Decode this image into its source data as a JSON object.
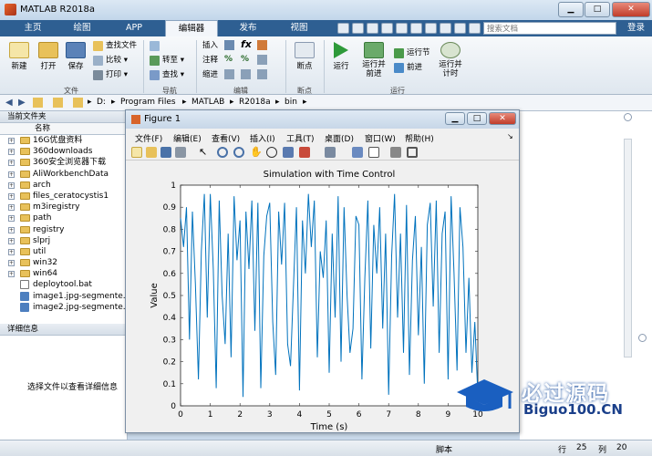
{
  "app": {
    "title": "MATLAB R2018a"
  },
  "tabs": [
    "主页",
    "绘图",
    "APP",
    "编辑器",
    "发布",
    "视图"
  ],
  "active_tab": "编辑器",
  "search": {
    "placeholder": "搜索文档"
  },
  "login_label": "登录",
  "ribbon": {
    "file": {
      "new": "新建",
      "open": "打开",
      "save": "保存",
      "find_files": "查找文件",
      "compare": "比较",
      "print": "打印",
      "group": "文件"
    },
    "nav": {
      "goto": "转至",
      "find": "查找",
      "group": "导航"
    },
    "edit": {
      "insert": "插入",
      "comment": "注释",
      "indent": "缩进",
      "group": "编辑"
    },
    "breakpoints": {
      "label": "断点",
      "group": "断点"
    },
    "run": {
      "run": "运行",
      "run_advance": "运行并\n前进",
      "run_section": "运行节",
      "advance": "前进",
      "run_time": "运行并\n计时",
      "group": "运行"
    }
  },
  "address": {
    "path": [
      "D:",
      "Program Files",
      "MATLAB",
      "R2018a",
      "bin"
    ]
  },
  "current_folder": {
    "title": "当前文件夹",
    "col_name": "名称",
    "items": [
      {
        "name": "16G优盘资料",
        "type": "folder"
      },
      {
        "name": "360downloads",
        "type": "folder"
      },
      {
        "name": "360安全浏览器下载",
        "type": "folder"
      },
      {
        "name": "AliWorkbenchData",
        "type": "folder"
      },
      {
        "name": "arch",
        "type": "folder"
      },
      {
        "name": "files_ceratocystis1",
        "type": "folder"
      },
      {
        "name": "m3iregistry",
        "type": "folder"
      },
      {
        "name": "path",
        "type": "folder"
      },
      {
        "name": "registry",
        "type": "folder"
      },
      {
        "name": "slprj",
        "type": "folder"
      },
      {
        "name": "util",
        "type": "folder"
      },
      {
        "name": "win32",
        "type": "folder"
      },
      {
        "name": "win64",
        "type": "folder"
      },
      {
        "name": "deploytool.bat",
        "type": "file"
      },
      {
        "name": "image1.jpg-segmente...",
        "type": "image"
      },
      {
        "name": "image2.jpg-segmente...",
        "type": "image"
      }
    ]
  },
  "details": {
    "title": "详细信息",
    "message": "选择文件以查看详细信息"
  },
  "status": {
    "script": "脚本",
    "row_label": "行",
    "row": "25",
    "col_label": "列",
    "col": "20"
  },
  "figure": {
    "title": "Figure 1",
    "menu": [
      "文件(F)",
      "编辑(E)",
      "查看(V)",
      "插入(I)",
      "工具(T)",
      "桌面(D)",
      "窗口(W)",
      "帮助(H)"
    ]
  },
  "watermark": {
    "line1": "必过源码",
    "line2": "Biguo100.CN"
  },
  "colors": {
    "tabbar": "#2e5f92",
    "line": "#0072bd",
    "ribbon_bg": "#eef2f6"
  },
  "chart_data": {
    "type": "line",
    "title": "Simulation with Time Control",
    "xlabel": "Time (s)",
    "ylabel": "Value",
    "xlim": [
      0,
      10
    ],
    "ylim": [
      0,
      1
    ],
    "xticks": [
      "0",
      "1",
      "2",
      "3",
      "4",
      "5",
      "6",
      "7",
      "8",
      "9",
      "10"
    ],
    "yticks": [
      "0",
      "0.1",
      "0.2",
      "0.3",
      "0.4",
      "0.5",
      "0.6",
      "0.7",
      "0.8",
      "0.9",
      "1"
    ],
    "series": [
      {
        "x": [
          0,
          0.1,
          0.2,
          0.3,
          0.4,
          0.5,
          0.6,
          0.7,
          0.8,
          0.9,
          1.0,
          1.1,
          1.2,
          1.3,
          1.4,
          1.5,
          1.6,
          1.7,
          1.8,
          1.9,
          2.0,
          2.1,
          2.2,
          2.3,
          2.4,
          2.5,
          2.6,
          2.7,
          2.8,
          2.9,
          3.0,
          3.1,
          3.2,
          3.3,
          3.4,
          3.5,
          3.6,
          3.7,
          3.8,
          3.9,
          4.0,
          4.1,
          4.2,
          4.3,
          4.4,
          4.5,
          4.6,
          4.7,
          4.8,
          4.9,
          5.0,
          5.1,
          5.2,
          5.3,
          5.4,
          5.5,
          5.6,
          5.7,
          5.8,
          5.9,
          6.0,
          6.1,
          6.2,
          6.3,
          6.4,
          6.5,
          6.6,
          6.7,
          6.8,
          6.9,
          7.0,
          7.1,
          7.2,
          7.3,
          7.4,
          7.5,
          7.6,
          7.7,
          7.8,
          7.9,
          8.0,
          8.1,
          8.2,
          8.3,
          8.4,
          8.5,
          8.6,
          8.7,
          8.8,
          8.9,
          9.0,
          9.1,
          9.2,
          9.3,
          9.4,
          9.5,
          9.6,
          9.7,
          9.8,
          9.9,
          10.0
        ],
        "y": [
          0.85,
          0.72,
          0.9,
          0.3,
          0.88,
          0.55,
          0.12,
          0.7,
          0.96,
          0.4,
          0.96,
          0.62,
          0.08,
          0.93,
          0.5,
          0.28,
          0.78,
          0.22,
          0.95,
          0.66,
          0.84,
          0.04,
          0.88,
          0.62,
          0.93,
          0.34,
          0.92,
          0.08,
          0.68,
          0.86,
          0.92,
          0.38,
          0.14,
          0.88,
          0.64,
          0.92,
          0.28,
          0.18,
          0.55,
          0.9,
          0.07,
          0.84,
          0.6,
          0.96,
          0.72,
          0.93,
          0.22,
          0.7,
          0.58,
          0.84,
          0.15,
          0.78,
          0.4,
          0.95,
          0.2,
          0.9,
          0.5,
          0.24,
          0.35,
          0.86,
          0.82,
          0.12,
          0.58,
          0.93,
          0.26,
          0.82,
          0.6,
          0.9,
          0.35,
          0.78,
          0.05,
          0.68,
          0.96,
          0.4,
          0.78,
          0.24,
          0.91,
          0.14,
          0.66,
          0.86,
          0.32,
          0.72,
          0.1,
          0.82,
          0.92,
          0.45,
          0.93,
          0.24,
          0.78,
          0.88,
          0.12,
          0.95,
          0.6,
          0.16,
          0.9,
          0.72,
          0.24,
          0.58,
          0.15,
          0.38,
          0.05
        ]
      }
    ]
  }
}
